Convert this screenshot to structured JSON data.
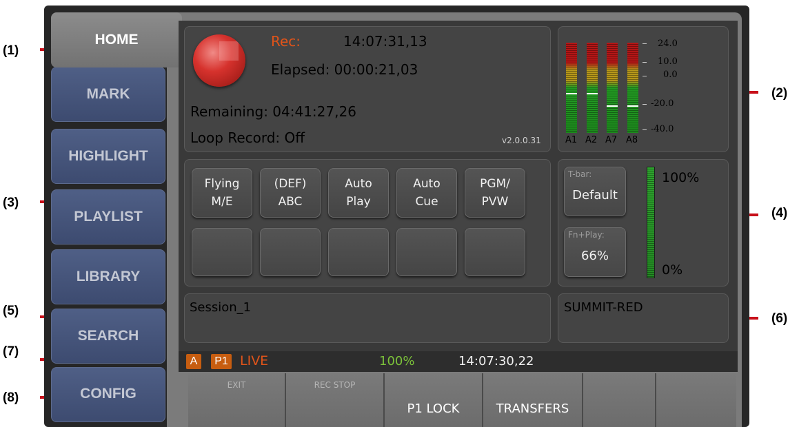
{
  "callouts": [
    "(1)",
    "(2)",
    "(3)",
    "(4)",
    "(5)",
    "(6)",
    "(7)",
    "(8)"
  ],
  "sidebar": {
    "active": "HOME",
    "items": [
      "MARK",
      "HIGHLIGHT",
      "PLAYLIST",
      "LIBRARY",
      "SEARCH",
      "CONFIG"
    ]
  },
  "record": {
    "rec_label": "Rec:",
    "rec_timecode": "14:07:31,13",
    "elapsed": "Elapsed: 00:00:21,03",
    "remaining": "Remaining: 04:41:27,26",
    "loop_record": "Loop Record: Off",
    "version": "v2.0.0.31"
  },
  "audio_meters": {
    "scale": [
      "24.0",
      "10.0",
      "0.0",
      "-20.0",
      "-40.0"
    ],
    "channels": [
      {
        "label": "A1",
        "peak_db": -10
      },
      {
        "label": "A2",
        "peak_db": -10
      },
      {
        "label": "A7",
        "peak_db": -20
      },
      {
        "label": "A8",
        "peak_db": -20
      }
    ]
  },
  "function_buttons": [
    "Flying\nM/E",
    "(DEF)\nABC",
    "Auto\nPlay",
    "Auto\nCue",
    "PGM/\nPVW",
    "",
    "",
    "",
    "",
    ""
  ],
  "tbar": {
    "tbar_caption": "T-bar:",
    "tbar_value": "Default",
    "fnplay_caption": "Fn+Play:",
    "fnplay_value": "66%",
    "top_label": "100%",
    "bottom_label": "0%",
    "level_percent": 100
  },
  "session": {
    "name": "Session_1"
  },
  "server": {
    "name": "SUMMIT-RED"
  },
  "status": {
    "badge_a": "A",
    "badge_p1": "P1",
    "live": "LIVE",
    "percent": "100%",
    "timecode": "14:07:30,22"
  },
  "softkeys": [
    {
      "small": "EXIT",
      "big": ""
    },
    {
      "small": "REC STOP",
      "big": ""
    },
    {
      "small": "",
      "big": "P1 LOCK"
    },
    {
      "small": "",
      "big": "TRANSFERS"
    },
    {
      "small": "",
      "big": ""
    },
    {
      "small": "",
      "big": ""
    }
  ],
  "colors": {
    "rec_label": "#e0541a",
    "live": "#e0541a",
    "percent": "#7cc23a",
    "callout_line": "#c8101a"
  }
}
